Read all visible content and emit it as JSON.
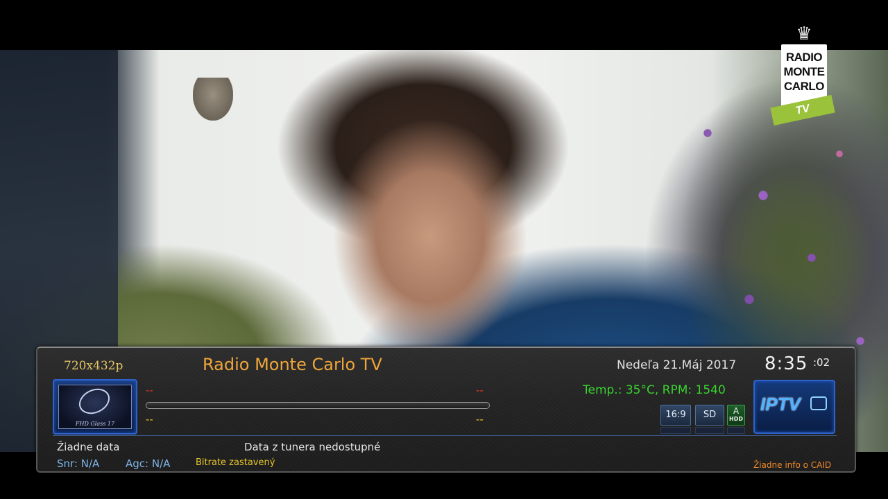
{
  "channel_logo": {
    "crown_icon": "crown-icon",
    "lines": [
      "RADIO",
      "MONTE",
      "CARLO"
    ],
    "tv": "TV",
    "accent": "#9bc23b"
  },
  "infobar": {
    "resolution": "720x432p",
    "channel_name": "Radio Monte Carlo TV",
    "date": "Nedeľa  21.Máj 2017",
    "clock": "8:35",
    "clock_seconds": ":02",
    "temp_rpm": "Temp.: 35°C, RPM: 1540",
    "picon_label": "FHD Glass 17",
    "dash_top_left": "--",
    "dash_top_right": "--",
    "dash_bottom_left": "--",
    "dash_bottom_right": "--",
    "badges": {
      "aspect": "16:9",
      "definition": "SD",
      "hdd_a": "A",
      "hdd": "HDD"
    },
    "iptv_logo": "IPTV",
    "no_data": "Žiadne data",
    "tuner_status": "Data z tunera nedostupné",
    "snr": "Snr: N/A",
    "agc": "Agc: N/A",
    "bitrate": "Bitrate zastavený",
    "caid": "Žiadne info o CAID"
  },
  "colors": {
    "channel_name": "#f0a53a",
    "temp": "#39d22e",
    "snr_agc": "#7fb4e6",
    "bitrate": "#e6c52a",
    "caid": "#f08a2a"
  }
}
